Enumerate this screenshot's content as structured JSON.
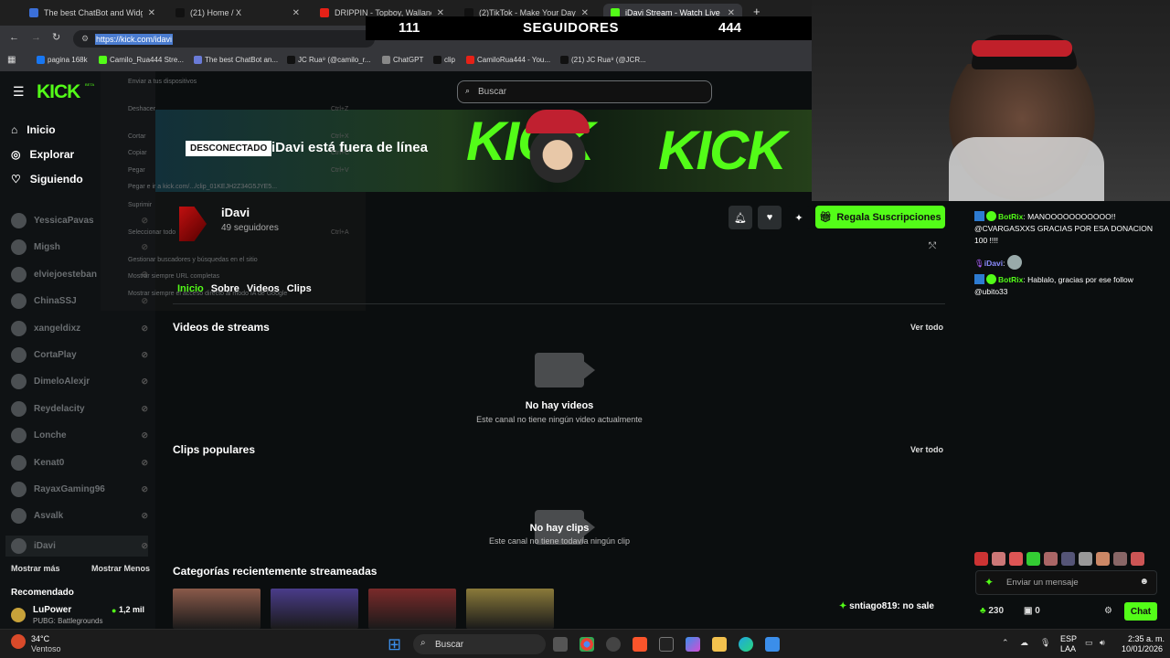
{
  "browser": {
    "tabs": [
      {
        "title": "The best ChatBot and Widgets",
        "color": "#3b6fd8"
      },
      {
        "title": "(21) Home / X",
        "color": "#111111"
      },
      {
        "title": "DRIPPIN - Topboy, Wallance, To",
        "color": "#e62117"
      },
      {
        "title": "(2)TikTok - Make Your Day",
        "color": "#111111"
      },
      {
        "title": "iDavi Stream - Watch Live on K",
        "color": "#53fc18"
      }
    ],
    "new_tab": "+",
    "url": "https://kick.com/idavi",
    "bookmarks": [
      "pagina 168k",
      "Camilo_Rua444 Stre...",
      "The best ChatBot an...",
      "JC Rua⁹ (@camilo_r...",
      "ChatGPT",
      "clip",
      "CamiloRua444 - You...",
      "(21) JC Rua⁹ (@JCR..."
    ]
  },
  "overlay": {
    "left_count": "111",
    "label": "SEGUIDORES",
    "right_count": "444"
  },
  "context_menu": {
    "items": [
      {
        "label": "Enviar a tus dispositivos",
        "key": ""
      },
      {
        "label": "Deshacer",
        "key": "Ctrl+Z"
      },
      {
        "label": "Cortar",
        "key": "Ctrl+X"
      },
      {
        "label": "Copiar",
        "key": "Ctrl+C"
      },
      {
        "label": "Pegar",
        "key": "Ctrl+V"
      },
      {
        "label": "Pegar e ir a kick.com/.../clip_01KEJH2Z34G5JYE5...",
        "key": ""
      },
      {
        "label": "Suprimir",
        "key": ""
      },
      {
        "label": "Seleccionar todo",
        "key": "Ctrl+A"
      },
      {
        "label": "Gestionar buscadores y búsquedas en el sitio",
        "key": ""
      },
      {
        "label": "Mostrar siempre URL completas",
        "key": ""
      },
      {
        "label": "Mostrar siempre el acceso directo al modo IA de Google",
        "key": ""
      }
    ]
  },
  "kick": {
    "logo": "KICK",
    "logo_sup": "BETA",
    "search_placeholder": "Buscar",
    "nav": [
      {
        "label": "Inicio",
        "icon": "home-icon"
      },
      {
        "label": "Explorar",
        "icon": "compass-icon"
      },
      {
        "label": "Siguiendo",
        "icon": "heart-icon"
      }
    ],
    "channels": [
      "YessicaPavas",
      "Migsh",
      "elviejoesteban",
      "ChinaSSJ",
      "xangeldixz",
      "CortaPlay",
      "DimeloAlexjr",
      "Reydelacity",
      "Lonche",
      "Kenat0",
      "RayaxGaming96",
      "Asvalk",
      "iDavi"
    ],
    "show_more": "Mostrar más",
    "show_less": "Mostrar Menos",
    "recommended_title": "Recomendado",
    "recommended": {
      "name": "LuPower",
      "game": "PUBG: Battlegrounds",
      "viewers": "1,2 mil"
    },
    "banner_word": "KICK",
    "offline_badge": "DESCONECTADO",
    "offline_text": "iDavi está fuera de línea",
    "channel_name": "iDavi",
    "followers": "49 seguidores",
    "subscribe_button": "Regala Suscripciones",
    "tabs": [
      "Inicio",
      "Sobre",
      "Videos",
      "Clips"
    ],
    "videos_section": {
      "title": "Videos de streams",
      "see_all": "Ver todo",
      "empty_title": "No hay videos",
      "empty_sub": "Este canal no tiene ningún video actualmente"
    },
    "clips_section": {
      "title": "Clips populares",
      "see_all": "Ver todo",
      "empty_title": "No hay clips",
      "empty_sub": "Este canal no tiene todavía ningún clip"
    },
    "categories_title": "Categorías recientemente streameadas",
    "category_colors": [
      "#8a5a4a",
      "#4a3c8a",
      "#7a2a2a",
      "#8a7a3a"
    ]
  },
  "chat": {
    "messages": [
      {
        "user": "BotRix",
        "text": "MANOOOOOOOOOOO!! @CVARGASXXS GRACIAS POR ESA DONACION 100 !!!!"
      },
      {
        "user": "iDavi",
        "text": ""
      },
      {
        "user": "BotRix",
        "text": "Hablalo, gracias por ese follow @ubito33"
      }
    ],
    "pinned": {
      "user": "sntiago819",
      "text": ": no sale"
    },
    "input_placeholder": "Enviar un mensaje",
    "points": "230",
    "gifts": "0",
    "chat_button": "Chat"
  },
  "taskbar": {
    "weather_temp": "34°C",
    "weather_desc": "Ventoso",
    "search_label": "Buscar",
    "lang_top": "ESP",
    "lang_bottom": "LAA",
    "time": "2:35 a. m.",
    "date": "10/01/2026"
  }
}
